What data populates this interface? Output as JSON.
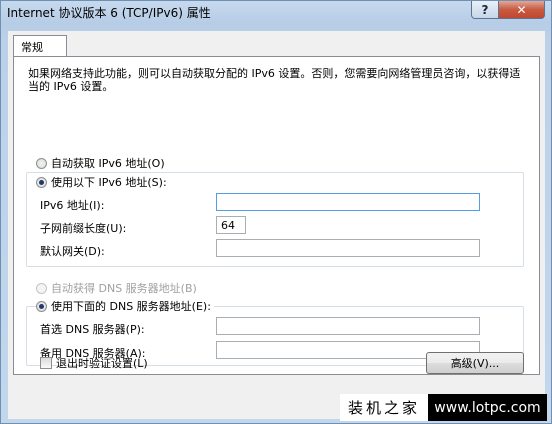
{
  "window": {
    "title": "Internet 协议版本 6 (TCP/IPv6) 属性",
    "help_label": "?",
    "close_label": "✕"
  },
  "tab": {
    "label": "常规"
  },
  "description": "如果网络支持此功能，则可以自动获取分配的 IPv6 设置。否则，您需要向网络管理员咨询，以获得适当的 IPv6 设置。",
  "ip": {
    "auto_label": "自动获取 IPv6 地址(O)",
    "manual_label": "使用以下 IPv6 地址(S):",
    "address_label": "IPv6 地址(I):",
    "address_value": "",
    "prefix_label": "子网前缀长度(U):",
    "prefix_value": "64",
    "gateway_label": "默认网关(D):",
    "gateway_value": ""
  },
  "dns": {
    "auto_label": "自动获得 DNS 服务器地址(B)",
    "manual_label": "使用下面的 DNS 服务器地址(E):",
    "preferred_label": "首选 DNS 服务器(P):",
    "preferred_value": "",
    "alternate_label": "备用 DNS 服务器(A):",
    "alternate_value": ""
  },
  "validate_label": "退出时验证设置(L)",
  "advanced_label": "高级(V)...",
  "watermark": {
    "text": "装机之家",
    "url": "www.lotpc.com"
  }
}
